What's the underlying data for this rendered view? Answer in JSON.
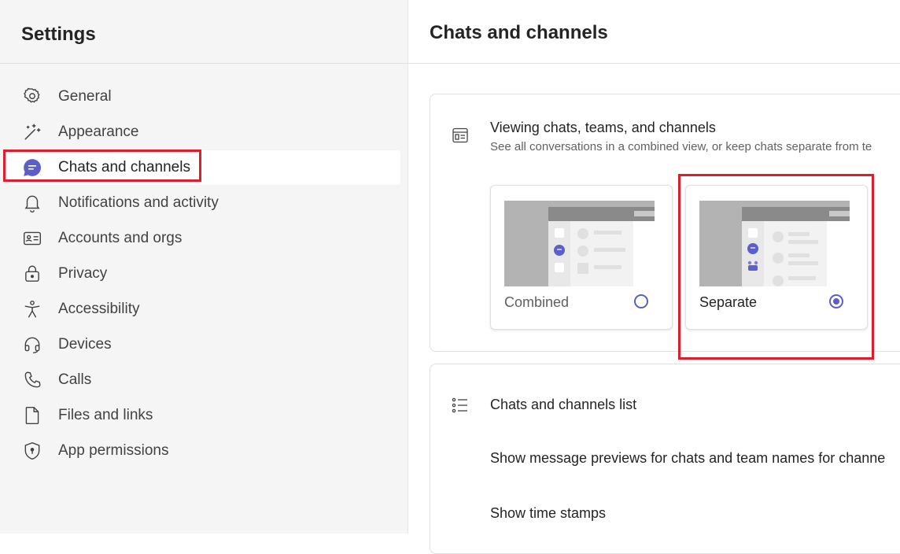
{
  "sidebar": {
    "title": "Settings",
    "items": [
      {
        "label": "General",
        "icon": "gear-icon"
      },
      {
        "label": "Appearance",
        "icon": "magic-wand-icon"
      },
      {
        "label": "Chats and channels",
        "icon": "chat-icon",
        "selected": true
      },
      {
        "label": "Notifications and activity",
        "icon": "bell-icon"
      },
      {
        "label": "Accounts and orgs",
        "icon": "id-card-icon"
      },
      {
        "label": "Privacy",
        "icon": "lock-icon"
      },
      {
        "label": "Accessibility",
        "icon": "accessibility-icon"
      },
      {
        "label": "Devices",
        "icon": "headset-icon"
      },
      {
        "label": "Calls",
        "icon": "phone-icon"
      },
      {
        "label": "Files and links",
        "icon": "file-icon"
      },
      {
        "label": "App permissions",
        "icon": "shield-icon"
      }
    ]
  },
  "main": {
    "title": "Chats and channels",
    "viewing": {
      "title": "Viewing chats, teams, and channels",
      "subtitle": "See all conversations in a combined view, or keep chats separate from te",
      "options": [
        {
          "label": "Combined",
          "checked": false
        },
        {
          "label": "Separate",
          "checked": true
        }
      ]
    },
    "list": {
      "title": "Chats and channels list",
      "rows": [
        "Show message previews for chats and team names for channe",
        "Show time stamps"
      ]
    }
  },
  "colors": {
    "accent": "#5b5fc7",
    "highlight": "#e01e2b",
    "sidebar_bg": "#f5f5f5"
  }
}
